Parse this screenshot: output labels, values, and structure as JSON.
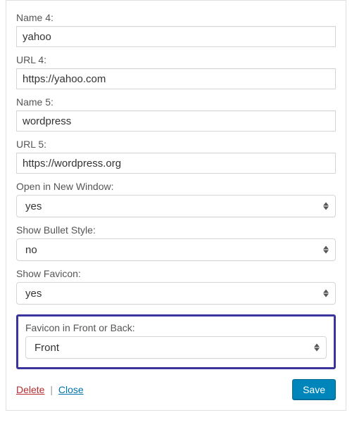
{
  "fields": {
    "name4": {
      "label": "Name 4:",
      "value": "yahoo"
    },
    "url4": {
      "label": "URL 4:",
      "value": "https://yahoo.com"
    },
    "name5": {
      "label": "Name 5:",
      "value": "wordpress"
    },
    "url5": {
      "label": "URL 5:",
      "value": "https://wordpress.org"
    },
    "open_new_window": {
      "label": "Open in New Window:",
      "value": "yes"
    },
    "show_bullet": {
      "label": "Show Bullet Style:",
      "value": "no"
    },
    "show_favicon": {
      "label": "Show Favicon:",
      "value": "yes"
    },
    "favicon_position": {
      "label": "Favicon in Front or Back:",
      "value": "Front"
    }
  },
  "footer": {
    "delete": "Delete",
    "sep": "|",
    "close": "Close",
    "save": "Save"
  }
}
